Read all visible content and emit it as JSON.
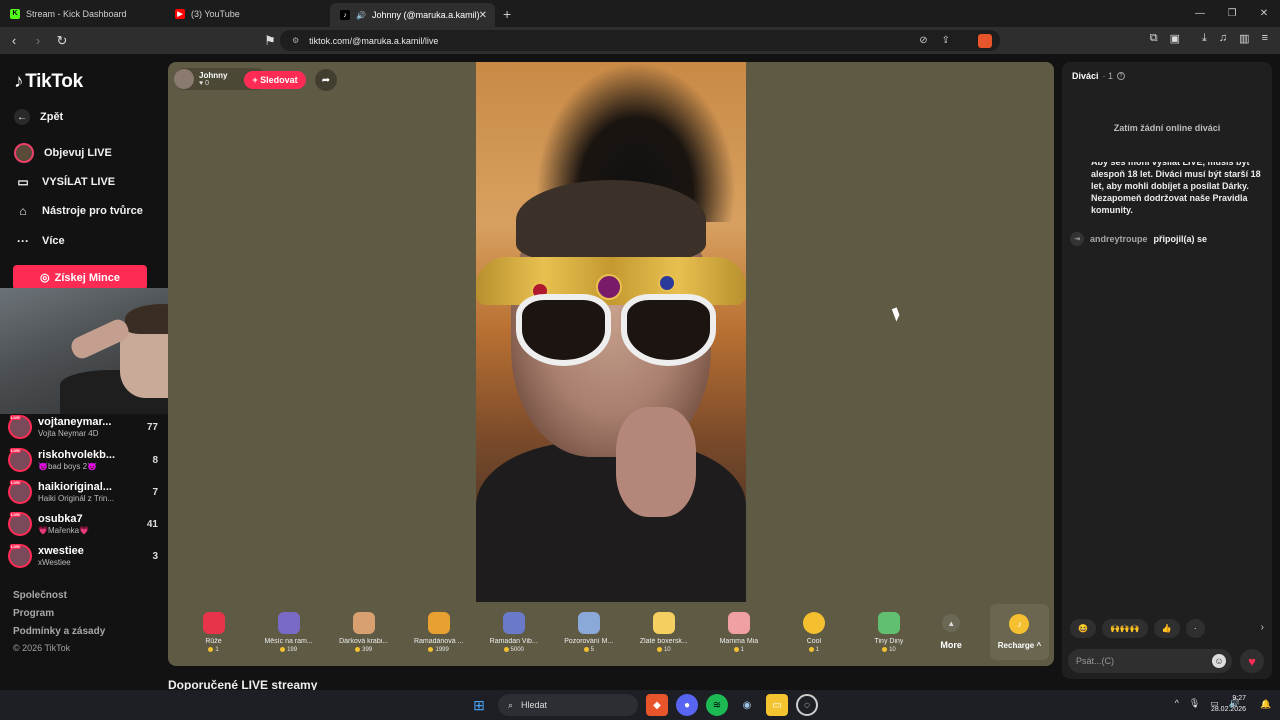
{
  "browser": {
    "tabs": [
      {
        "title": "Stream - Kick Dashboard",
        "icon": "kick-icon",
        "color": "#53fc18"
      },
      {
        "title": "(3) YouTube",
        "icon": "youtube-icon",
        "color": "#ff0000"
      },
      {
        "title": "Johnny (@maruka.a.kamil) vy",
        "icon": "tiktok-icon",
        "color": "#000000",
        "active": true
      }
    ],
    "new_tab": "+",
    "url": "tiktok.com/@maruka.a.kamil/live"
  },
  "sidebar": {
    "logo": "TikTok",
    "back": "Zpět",
    "items": [
      {
        "label": "Objevuj LIVE",
        "icon": "live-avatar-icon"
      },
      {
        "label": "VYSÍLAT LIVE",
        "icon": "camera-icon"
      },
      {
        "label": "Nástroje pro tvůrce",
        "icon": "home-tools-icon"
      },
      {
        "label": "Více",
        "icon": "more-dots-icon"
      }
    ],
    "coins_button": "Získej Mince",
    "suggested": [
      {
        "name": "vojtaneymar...",
        "sub": "Vojta Neymar 4D",
        "count": "77"
      },
      {
        "name": "riskohvolekb...",
        "sub": "😈bad boys 2😈",
        "count": "8"
      },
      {
        "name": "haikioriginal...",
        "sub": "Haiki Originál z Trin...",
        "count": "7"
      },
      {
        "name": "osubka7",
        "sub": "💗Mařenka💗",
        "count": "41"
      },
      {
        "name": "xwestiee",
        "sub": "xWestiee",
        "count": "3"
      }
    ],
    "footer_links": [
      "Společnost",
      "Program",
      "Podmínky a zásady"
    ],
    "copyright": "© 2026 TikTok"
  },
  "stream": {
    "host_name": "Johnny",
    "host_likes": "0",
    "follow_label": "+ Sledovat",
    "gifts": [
      {
        "name": "Růže",
        "price": "1",
        "color": "#e8344a"
      },
      {
        "name": "Měsíc na ram...",
        "price": "199",
        "color": "#7a6ac8"
      },
      {
        "name": "Dárková krabi...",
        "price": "399",
        "color": "#d8a070"
      },
      {
        "name": "Ramadánová ...",
        "price": "1999",
        "color": "#e8a030"
      },
      {
        "name": "Ramadan Vib...",
        "price": "5000",
        "color": "#6a7ac8"
      },
      {
        "name": "Pozorování M...",
        "price": "5",
        "color": "#8aa8d8"
      },
      {
        "name": "Zlaté boxersk...",
        "price": "10",
        "color": "#f4d060"
      },
      {
        "name": "Mamma Mia",
        "price": "1",
        "color": "#f0a0a0"
      },
      {
        "name": "Cool",
        "price": "1",
        "color": "#f4c030"
      },
      {
        "name": "Tiny Diny",
        "price": "10",
        "color": "#60c070"
      }
    ],
    "more_label": "More",
    "recharge_label": "Recharge ^",
    "recommended_title": "Doporučené LIVE streamy"
  },
  "chat": {
    "viewers_label": "Diváci",
    "viewers_count": "· 1",
    "no_viewers": "Zatím žádní online diváci",
    "rules": "Aby ses mohl vysílat LIVE, musíš být alespoň 18 let. Diváci musí být starší 18 let, aby mohli dobíjet a posílat Dárky. Nezapomeň dodržovat naše Pravidla komunity.",
    "join_user": "andreytroupe",
    "join_action": "připojil(a) se",
    "quick_reacts": [
      "😆",
      "🙌🙌🙌",
      "👍",
      "·"
    ],
    "input_placeholder": "Psát...(C)"
  },
  "taskbar": {
    "search": "Hledat",
    "time": "9:27",
    "date": "28.02.2026"
  }
}
